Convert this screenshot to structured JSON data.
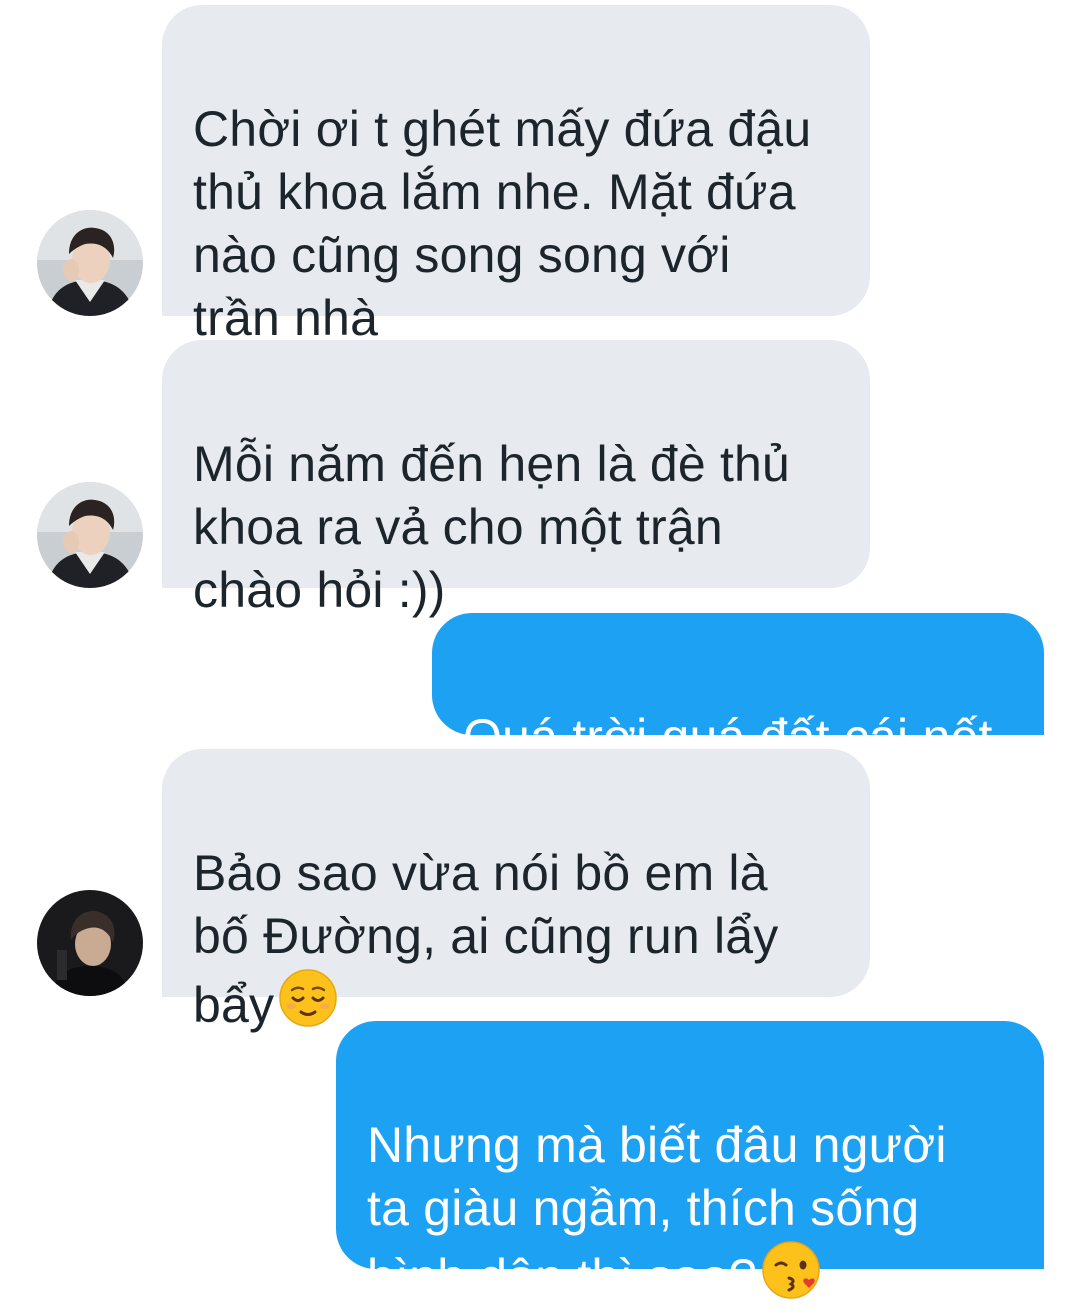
{
  "messages": [
    {
      "sender": "other",
      "avatar": "avatar-light-portrait",
      "text": "Chời ơi t ghét mấy đứa đậu\nthủ khoa lắm nhe. Mặt đứa\nnào cũng song song với\ntrần nhà"
    },
    {
      "sender": "other",
      "avatar": "avatar-light-portrait",
      "text": "Mỗi năm đến hẹn là đè thủ\nkhoa ra vả cho một trận\nchào hỏi :))"
    },
    {
      "sender": "me",
      "text": "Quá trời quá đất cái nết"
    },
    {
      "sender": "other",
      "avatar": "avatar-dark-portrait",
      "text": "Bảo sao vừa nói bồ em là\nbố Đường, ai cũng run lẩy\nbẩy",
      "emoji": "relieved-face-icon"
    },
    {
      "sender": "me",
      "text": "Nhưng mà biết đâu người\nta giàu ngầm, thích sống\nbình dân thì sao?",
      "emoji": "kissing-face-icon"
    }
  ],
  "colors": {
    "incoming_bg": "#e7ebef",
    "incoming_text": "#1d252c",
    "outgoing_bg": "#1da1f2",
    "outgoing_text": "#ffffff"
  }
}
